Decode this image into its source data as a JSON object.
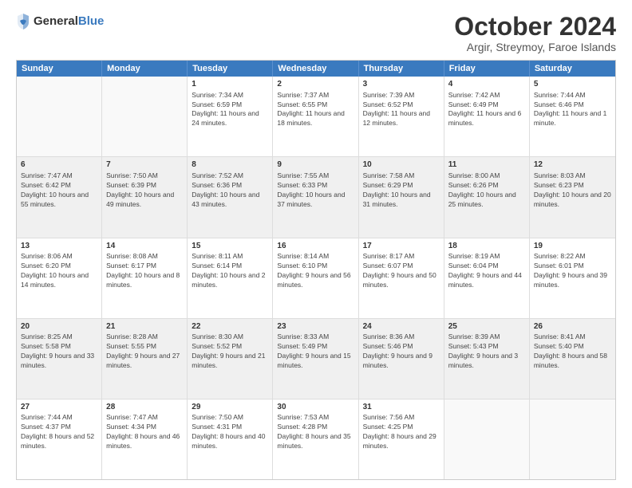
{
  "logo": {
    "general": "General",
    "blue": "Blue"
  },
  "title": "October 2024",
  "subtitle": "Argir, Streymoy, Faroe Islands",
  "header_days": [
    "Sunday",
    "Monday",
    "Tuesday",
    "Wednesday",
    "Thursday",
    "Friday",
    "Saturday"
  ],
  "weeks": [
    [
      {
        "day": "",
        "sunrise": "",
        "sunset": "",
        "daylight": "",
        "shaded": false,
        "empty": true
      },
      {
        "day": "",
        "sunrise": "",
        "sunset": "",
        "daylight": "",
        "shaded": false,
        "empty": true
      },
      {
        "day": "1",
        "sunrise": "Sunrise: 7:34 AM",
        "sunset": "Sunset: 6:59 PM",
        "daylight": "Daylight: 11 hours and 24 minutes.",
        "shaded": false,
        "empty": false
      },
      {
        "day": "2",
        "sunrise": "Sunrise: 7:37 AM",
        "sunset": "Sunset: 6:55 PM",
        "daylight": "Daylight: 11 hours and 18 minutes.",
        "shaded": false,
        "empty": false
      },
      {
        "day": "3",
        "sunrise": "Sunrise: 7:39 AM",
        "sunset": "Sunset: 6:52 PM",
        "daylight": "Daylight: 11 hours and 12 minutes.",
        "shaded": false,
        "empty": false
      },
      {
        "day": "4",
        "sunrise": "Sunrise: 7:42 AM",
        "sunset": "Sunset: 6:49 PM",
        "daylight": "Daylight: 11 hours and 6 minutes.",
        "shaded": false,
        "empty": false
      },
      {
        "day": "5",
        "sunrise": "Sunrise: 7:44 AM",
        "sunset": "Sunset: 6:46 PM",
        "daylight": "Daylight: 11 hours and 1 minute.",
        "shaded": false,
        "empty": false
      }
    ],
    [
      {
        "day": "6",
        "sunrise": "Sunrise: 7:47 AM",
        "sunset": "Sunset: 6:42 PM",
        "daylight": "Daylight: 10 hours and 55 minutes.",
        "shaded": true,
        "empty": false
      },
      {
        "day": "7",
        "sunrise": "Sunrise: 7:50 AM",
        "sunset": "Sunset: 6:39 PM",
        "daylight": "Daylight: 10 hours and 49 minutes.",
        "shaded": true,
        "empty": false
      },
      {
        "day": "8",
        "sunrise": "Sunrise: 7:52 AM",
        "sunset": "Sunset: 6:36 PM",
        "daylight": "Daylight: 10 hours and 43 minutes.",
        "shaded": true,
        "empty": false
      },
      {
        "day": "9",
        "sunrise": "Sunrise: 7:55 AM",
        "sunset": "Sunset: 6:33 PM",
        "daylight": "Daylight: 10 hours and 37 minutes.",
        "shaded": true,
        "empty": false
      },
      {
        "day": "10",
        "sunrise": "Sunrise: 7:58 AM",
        "sunset": "Sunset: 6:29 PM",
        "daylight": "Daylight: 10 hours and 31 minutes.",
        "shaded": true,
        "empty": false
      },
      {
        "day": "11",
        "sunrise": "Sunrise: 8:00 AM",
        "sunset": "Sunset: 6:26 PM",
        "daylight": "Daylight: 10 hours and 25 minutes.",
        "shaded": true,
        "empty": false
      },
      {
        "day": "12",
        "sunrise": "Sunrise: 8:03 AM",
        "sunset": "Sunset: 6:23 PM",
        "daylight": "Daylight: 10 hours and 20 minutes.",
        "shaded": true,
        "empty": false
      }
    ],
    [
      {
        "day": "13",
        "sunrise": "Sunrise: 8:06 AM",
        "sunset": "Sunset: 6:20 PM",
        "daylight": "Daylight: 10 hours and 14 minutes.",
        "shaded": false,
        "empty": false
      },
      {
        "day": "14",
        "sunrise": "Sunrise: 8:08 AM",
        "sunset": "Sunset: 6:17 PM",
        "daylight": "Daylight: 10 hours and 8 minutes.",
        "shaded": false,
        "empty": false
      },
      {
        "day": "15",
        "sunrise": "Sunrise: 8:11 AM",
        "sunset": "Sunset: 6:14 PM",
        "daylight": "Daylight: 10 hours and 2 minutes.",
        "shaded": false,
        "empty": false
      },
      {
        "day": "16",
        "sunrise": "Sunrise: 8:14 AM",
        "sunset": "Sunset: 6:10 PM",
        "daylight": "Daylight: 9 hours and 56 minutes.",
        "shaded": false,
        "empty": false
      },
      {
        "day": "17",
        "sunrise": "Sunrise: 8:17 AM",
        "sunset": "Sunset: 6:07 PM",
        "daylight": "Daylight: 9 hours and 50 minutes.",
        "shaded": false,
        "empty": false
      },
      {
        "day": "18",
        "sunrise": "Sunrise: 8:19 AM",
        "sunset": "Sunset: 6:04 PM",
        "daylight": "Daylight: 9 hours and 44 minutes.",
        "shaded": false,
        "empty": false
      },
      {
        "day": "19",
        "sunrise": "Sunrise: 8:22 AM",
        "sunset": "Sunset: 6:01 PM",
        "daylight": "Daylight: 9 hours and 39 minutes.",
        "shaded": false,
        "empty": false
      }
    ],
    [
      {
        "day": "20",
        "sunrise": "Sunrise: 8:25 AM",
        "sunset": "Sunset: 5:58 PM",
        "daylight": "Daylight: 9 hours and 33 minutes.",
        "shaded": true,
        "empty": false
      },
      {
        "day": "21",
        "sunrise": "Sunrise: 8:28 AM",
        "sunset": "Sunset: 5:55 PM",
        "daylight": "Daylight: 9 hours and 27 minutes.",
        "shaded": true,
        "empty": false
      },
      {
        "day": "22",
        "sunrise": "Sunrise: 8:30 AM",
        "sunset": "Sunset: 5:52 PM",
        "daylight": "Daylight: 9 hours and 21 minutes.",
        "shaded": true,
        "empty": false
      },
      {
        "day": "23",
        "sunrise": "Sunrise: 8:33 AM",
        "sunset": "Sunset: 5:49 PM",
        "daylight": "Daylight: 9 hours and 15 minutes.",
        "shaded": true,
        "empty": false
      },
      {
        "day": "24",
        "sunrise": "Sunrise: 8:36 AM",
        "sunset": "Sunset: 5:46 PM",
        "daylight": "Daylight: 9 hours and 9 minutes.",
        "shaded": true,
        "empty": false
      },
      {
        "day": "25",
        "sunrise": "Sunrise: 8:39 AM",
        "sunset": "Sunset: 5:43 PM",
        "daylight": "Daylight: 9 hours and 3 minutes.",
        "shaded": true,
        "empty": false
      },
      {
        "day": "26",
        "sunrise": "Sunrise: 8:41 AM",
        "sunset": "Sunset: 5:40 PM",
        "daylight": "Daylight: 8 hours and 58 minutes.",
        "shaded": true,
        "empty": false
      }
    ],
    [
      {
        "day": "27",
        "sunrise": "Sunrise: 7:44 AM",
        "sunset": "Sunset: 4:37 PM",
        "daylight": "Daylight: 8 hours and 52 minutes.",
        "shaded": false,
        "empty": false
      },
      {
        "day": "28",
        "sunrise": "Sunrise: 7:47 AM",
        "sunset": "Sunset: 4:34 PM",
        "daylight": "Daylight: 8 hours and 46 minutes.",
        "shaded": false,
        "empty": false
      },
      {
        "day": "29",
        "sunrise": "Sunrise: 7:50 AM",
        "sunset": "Sunset: 4:31 PM",
        "daylight": "Daylight: 8 hours and 40 minutes.",
        "shaded": false,
        "empty": false
      },
      {
        "day": "30",
        "sunrise": "Sunrise: 7:53 AM",
        "sunset": "Sunset: 4:28 PM",
        "daylight": "Daylight: 8 hours and 35 minutes.",
        "shaded": false,
        "empty": false
      },
      {
        "day": "31",
        "sunrise": "Sunrise: 7:56 AM",
        "sunset": "Sunset: 4:25 PM",
        "daylight": "Daylight: 8 hours and 29 minutes.",
        "shaded": false,
        "empty": false
      },
      {
        "day": "",
        "sunrise": "",
        "sunset": "",
        "daylight": "",
        "shaded": false,
        "empty": true
      },
      {
        "day": "",
        "sunrise": "",
        "sunset": "",
        "daylight": "",
        "shaded": false,
        "empty": true
      }
    ]
  ]
}
